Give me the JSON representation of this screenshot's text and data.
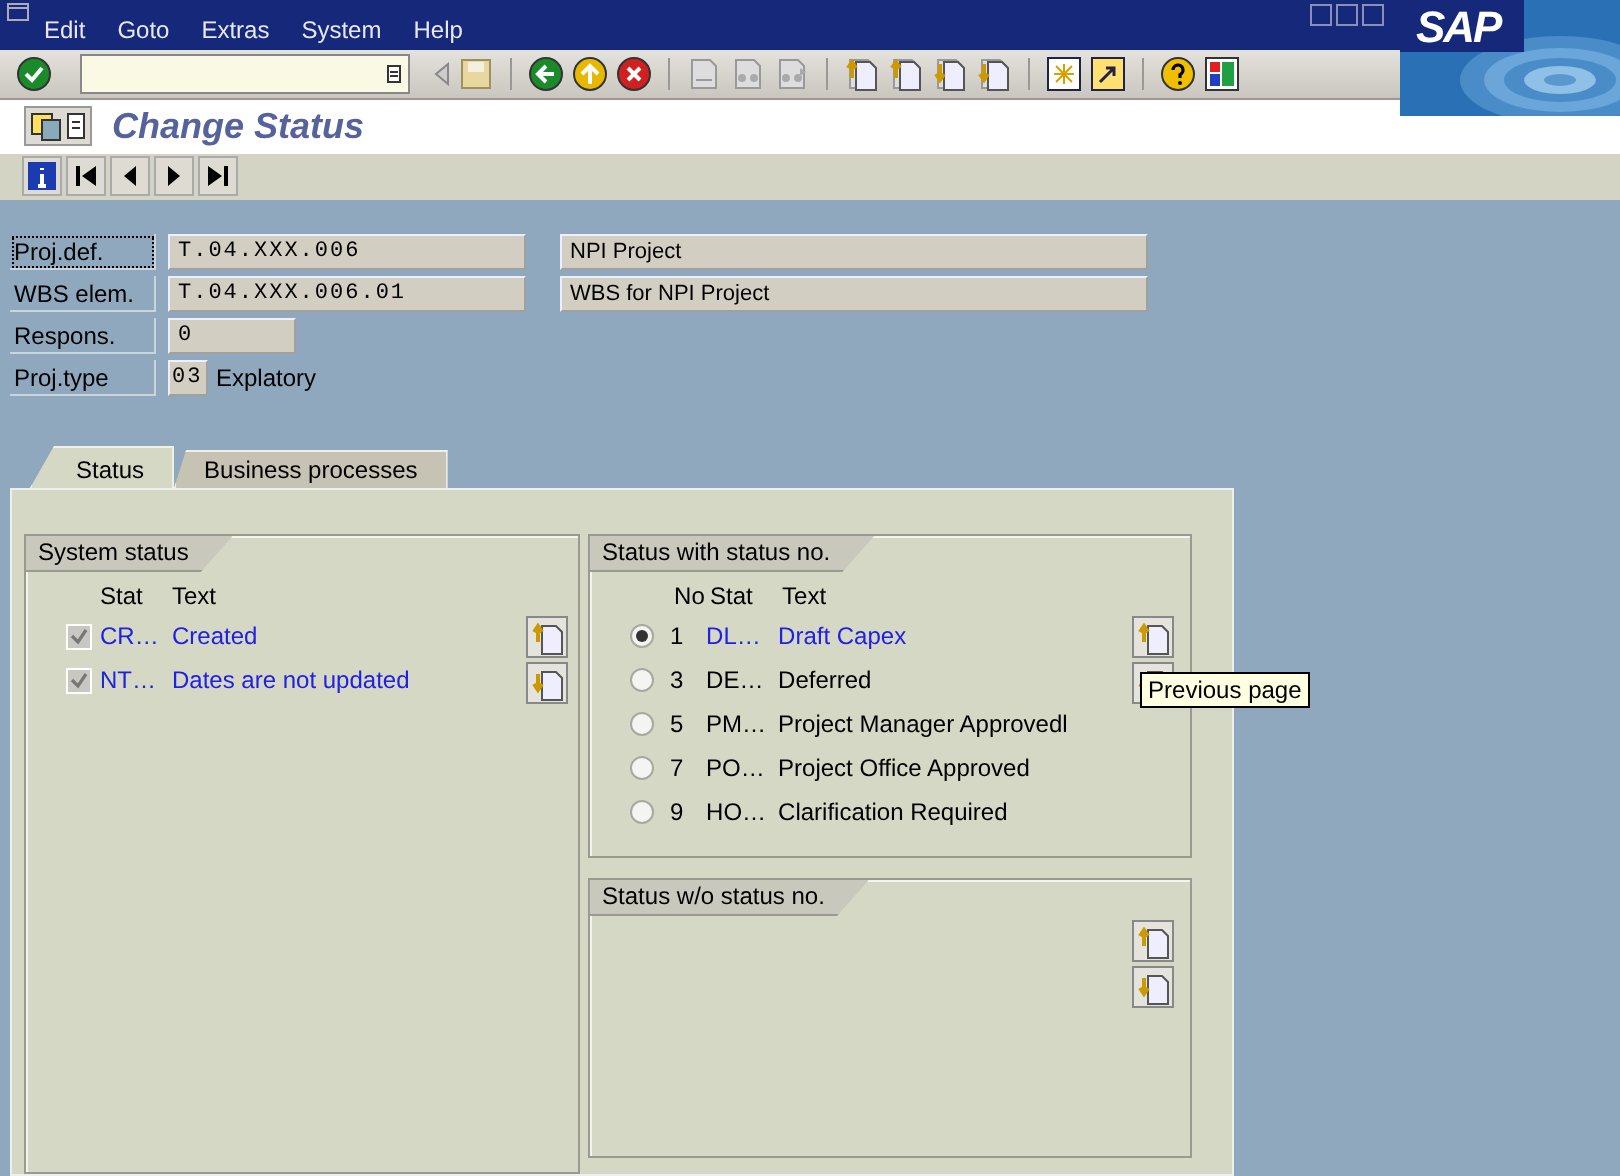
{
  "menu_bar": {
    "items": [
      "Edit",
      "Goto",
      "Extras",
      "System",
      "Help"
    ],
    "logo": "SAP"
  },
  "title": "Change Status",
  "header_fields": [
    {
      "kind": "entry",
      "label": "Proj.def.",
      "focused": true,
      "value": "T.04.XXX.006",
      "description": "NPI Project"
    },
    {
      "kind": "entry",
      "label": "WBS elem.",
      "focused": false,
      "value": "T.04.XXX.006.01",
      "description": "WBS for NPI Project"
    },
    {
      "kind": "short",
      "label": "Respons.",
      "focused": false,
      "value": "0"
    },
    {
      "kind": "code",
      "label": "Proj.type",
      "focused": false,
      "value": "03",
      "description": "Explatory"
    }
  ],
  "tabs": [
    {
      "label": "Status",
      "selected": true
    },
    {
      "label": "Business processes",
      "selected": false
    }
  ],
  "system_status": {
    "title": "System status",
    "columns": [
      "Stat",
      "Text"
    ],
    "rows": [
      {
        "stat": "CR…",
        "text": "Created",
        "checked": true
      },
      {
        "stat": "NT…",
        "text": "Dates are not updated",
        "checked": true
      }
    ]
  },
  "status_with_no": {
    "title": "Status with status no.",
    "columns": [
      "No",
      "Stat",
      "Text"
    ],
    "rows": [
      {
        "no": "1",
        "stat": "DL…",
        "text": "Draft Capex",
        "selected": true
      },
      {
        "no": "3",
        "stat": "DE…",
        "text": "Deferred",
        "selected": false
      },
      {
        "no": "5",
        "stat": "PM…",
        "text": "Project Manager Approvedl",
        "selected": false
      },
      {
        "no": "7",
        "stat": "PO…",
        "text": "Project Office Approved",
        "selected": false
      },
      {
        "no": "9",
        "stat": "HO…",
        "text": "Clarification Required",
        "selected": false
      }
    ]
  },
  "status_without_no": {
    "title": "Status w/o status no."
  },
  "tooltip": {
    "text": "Previous page"
  }
}
